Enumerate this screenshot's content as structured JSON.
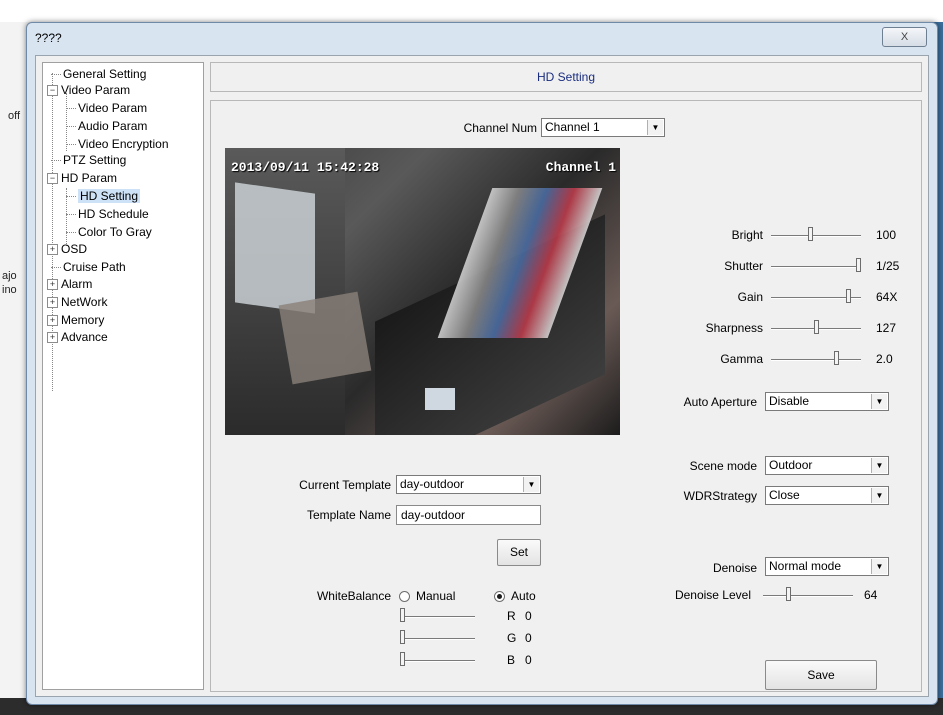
{
  "window": {
    "title": "????",
    "close_glyph": "X"
  },
  "background": {
    "frag1": "off",
    "frag2": "ajo",
    "frag3": "ino"
  },
  "tree": {
    "general": "General Setting",
    "video_param": "Video Param",
    "video_param_sub": "Video Param",
    "audio_param": "Audio Param",
    "video_encryption": "Video Encryption",
    "ptz": "PTZ Setting",
    "hd_param": "HD Param",
    "hd_setting": "HD Setting",
    "hd_schedule": "HD Schedule",
    "color_to_gray": "Color To Gray",
    "osd": "OSD",
    "cruise": "Cruise Path",
    "alarm": "Alarm",
    "network": "NetWork",
    "memory": "Memory",
    "advance": "Advance"
  },
  "header": {
    "title": "HD Setting"
  },
  "channel": {
    "label": "Channel Num",
    "value": "Channel  1"
  },
  "video": {
    "timestamp": "2013/09/11 15:42:28",
    "channel_osd": "Channel 1"
  },
  "image": {
    "bright": {
      "label": "Bright",
      "value": "100",
      "level": 0.43
    },
    "shutter": {
      "label": "Shutter",
      "value": "1/25",
      "level": 1.0
    },
    "gain": {
      "label": "Gain",
      "value": "64X",
      "level": 0.85
    },
    "sharpness": {
      "label": "Sharpness",
      "value": "127",
      "level": 0.5
    },
    "gamma": {
      "label": "Gamma",
      "value": "2.0",
      "level": 0.72
    }
  },
  "auto_aperture": {
    "label": "Auto Aperture",
    "value": "Disable"
  },
  "scene_mode": {
    "label": "Scene mode",
    "value": "Outdoor"
  },
  "wdr": {
    "label": "WDRStrategy",
    "value": "Close"
  },
  "denoise": {
    "label": "Denoise",
    "value": "Normal mode"
  },
  "denoise_level": {
    "label": "Denoise Level",
    "value": "64",
    "level": 0.28
  },
  "template": {
    "current_label": "Current Template",
    "current_value": "day-outdoor",
    "name_label": "Template Name",
    "name_value": "day-outdoor",
    "set_label": "Set"
  },
  "white_balance": {
    "label": "WhiteBalance",
    "manual_label": "Manual",
    "auto_label": "Auto",
    "r_label": "R",
    "r_value": "0",
    "g_label": "G",
    "g_value": "0",
    "b_label": "B",
    "b_value": "0"
  },
  "save_label": "Save"
}
